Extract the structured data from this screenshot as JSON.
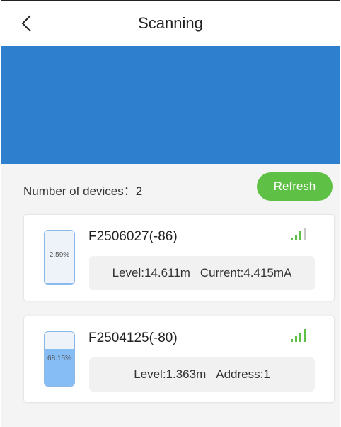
{
  "header": {
    "title": "Scanning"
  },
  "colors": {
    "banner": "#2f7fcf",
    "refresh": "#5ec146",
    "signal_on": "#5ec146",
    "signal_off": "#c8c8c8",
    "tank_fill": "#86bdf5"
  },
  "summary": {
    "count_label": "Number of devices：2",
    "refresh_label": "Refresh"
  },
  "devices": [
    {
      "name": "F2506027(-86)",
      "fill_percent_text": "2.59%",
      "fill_fraction": 0.0259,
      "signal_bars_active": 3,
      "info": [
        "Level:14.611m",
        "Current:4.415mA"
      ]
    },
    {
      "name": "F2504125(-80)",
      "fill_percent_text": "68.15%",
      "fill_fraction": 0.6815,
      "signal_bars_active": 4,
      "info": [
        "Level:1.363m",
        "Address:1"
      ]
    }
  ]
}
